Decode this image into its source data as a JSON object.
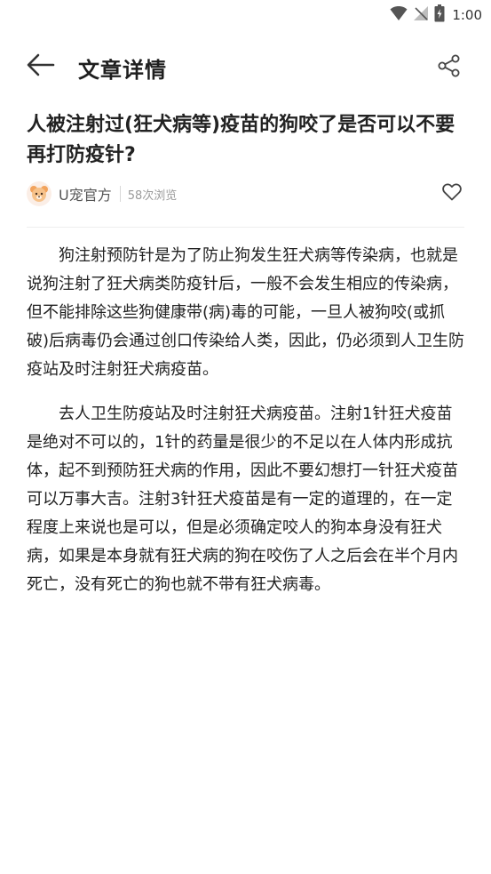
{
  "status_bar": {
    "time": "1:00",
    "icons": [
      "wifi-icon",
      "no-signal-icon",
      "battery-icon"
    ]
  },
  "header": {
    "title": "文章详情",
    "back_icon": "arrow-left-icon",
    "share_icon": "share-icon"
  },
  "article": {
    "title": "人被注射过(狂犬病等)疫苗的狗咬了是否可以不要再打防疫针?",
    "author": "U宠官方",
    "views": "58次浏览",
    "like_icon": "heart-outline-icon",
    "paragraphs": [
      "狗注射预防针是为了防止狗发生狂犬病等传染病，也就是说狗注射了狂犬病类防疫针后，一般不会发生相应的传染病，但不能排除这些狗健康带(病)毒的可能，一旦人被狗咬(或抓破)后病毒仍会通过创口传染给人类，因此，仍必须到人卫生防疫站及时注射狂犬病疫苗。",
      "去人卫生防疫站及时注射狂犬病疫苗。注射1针狂犬疫苗是绝对不可以的，1针的药量是很少的不足以在人体内形成抗体，起不到预防狂犬病的作用，因此不要幻想打一针狂犬疫苗可以万事大吉。注射3针狂犬疫苗是有一定的道理的，在一定程度上来说也是可以，但是必须确定咬人的狗本身没有狂犬病，如果是本身就有狂犬病的狗在咬伤了人之后会在半个月内死亡，没有死亡的狗也就不带有狂犬病毒。"
    ]
  },
  "colors": {
    "text_primary": "#222222",
    "text_secondary": "#555555",
    "text_muted": "#9a9a9a",
    "divider": "#eeeeee"
  }
}
